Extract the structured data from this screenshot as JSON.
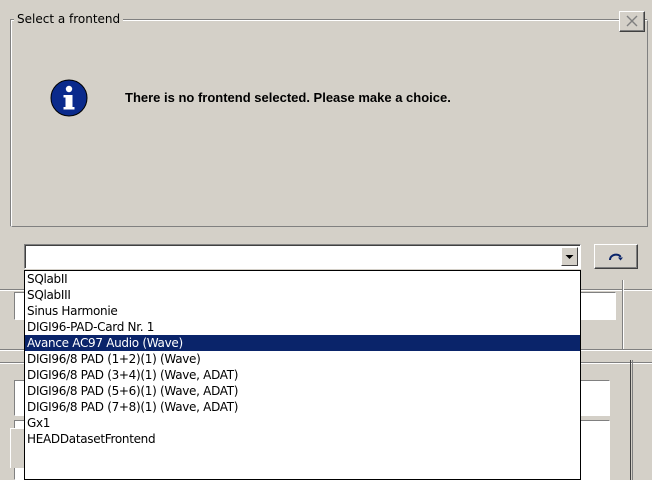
{
  "dialog": {
    "group_title": "Select a frontend",
    "message": "There is no frontend selected. Please make a choice.",
    "info_icon": "info-icon",
    "close_icon": "close-icon"
  },
  "frontend_combo": {
    "value": "",
    "arrow_icon": "chevron-down-icon"
  },
  "refresh_button": {
    "icon": "refresh-icon"
  },
  "dropdown": {
    "selected_index": 4,
    "items": [
      "SQlabII",
      "SQlabIII",
      "Sinus Harmonie",
      "DIGI96-PAD-Card Nr. 1",
      "Avance AC97 Audio (Wave)",
      "DIGI96/8 PAD (1+2)(1) (Wave)",
      "DIGI96/8 PAD (3+4)(1) (Wave, ADAT)",
      "DIGI96/8 PAD (5+6)(1) (Wave, ADAT)",
      "DIGI96/8 PAD (7+8)(1) (Wave, ADAT)",
      "Gx1",
      "HEADDatasetFrontend"
    ]
  },
  "colors": {
    "face": "#d4d0c8",
    "selection": "#0a246a",
    "info_blue": "#0a2a8c"
  }
}
